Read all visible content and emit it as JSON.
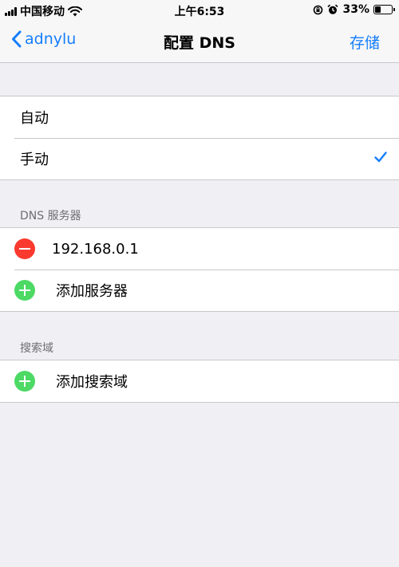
{
  "status_bar": {
    "carrier": "中国移动",
    "time": "上午6:53",
    "battery_percent": "33%",
    "battery_level": 0.33
  },
  "nav": {
    "back_label": "adnylu",
    "title": "配置 DNS",
    "save_label": "存储"
  },
  "mode": {
    "options": [
      {
        "label": "自动",
        "selected": false
      },
      {
        "label": "手动",
        "selected": true
      }
    ]
  },
  "dns_servers": {
    "header": "DNS 服务器",
    "servers": [
      "192.168.0.1"
    ],
    "add_label": "添加服务器"
  },
  "search_domains": {
    "header": "搜索域",
    "add_label": "添加搜索域"
  },
  "colors": {
    "accent": "#157efb",
    "delete": "#fb3a2f",
    "add": "#4cd964",
    "background": "#efeff4"
  }
}
